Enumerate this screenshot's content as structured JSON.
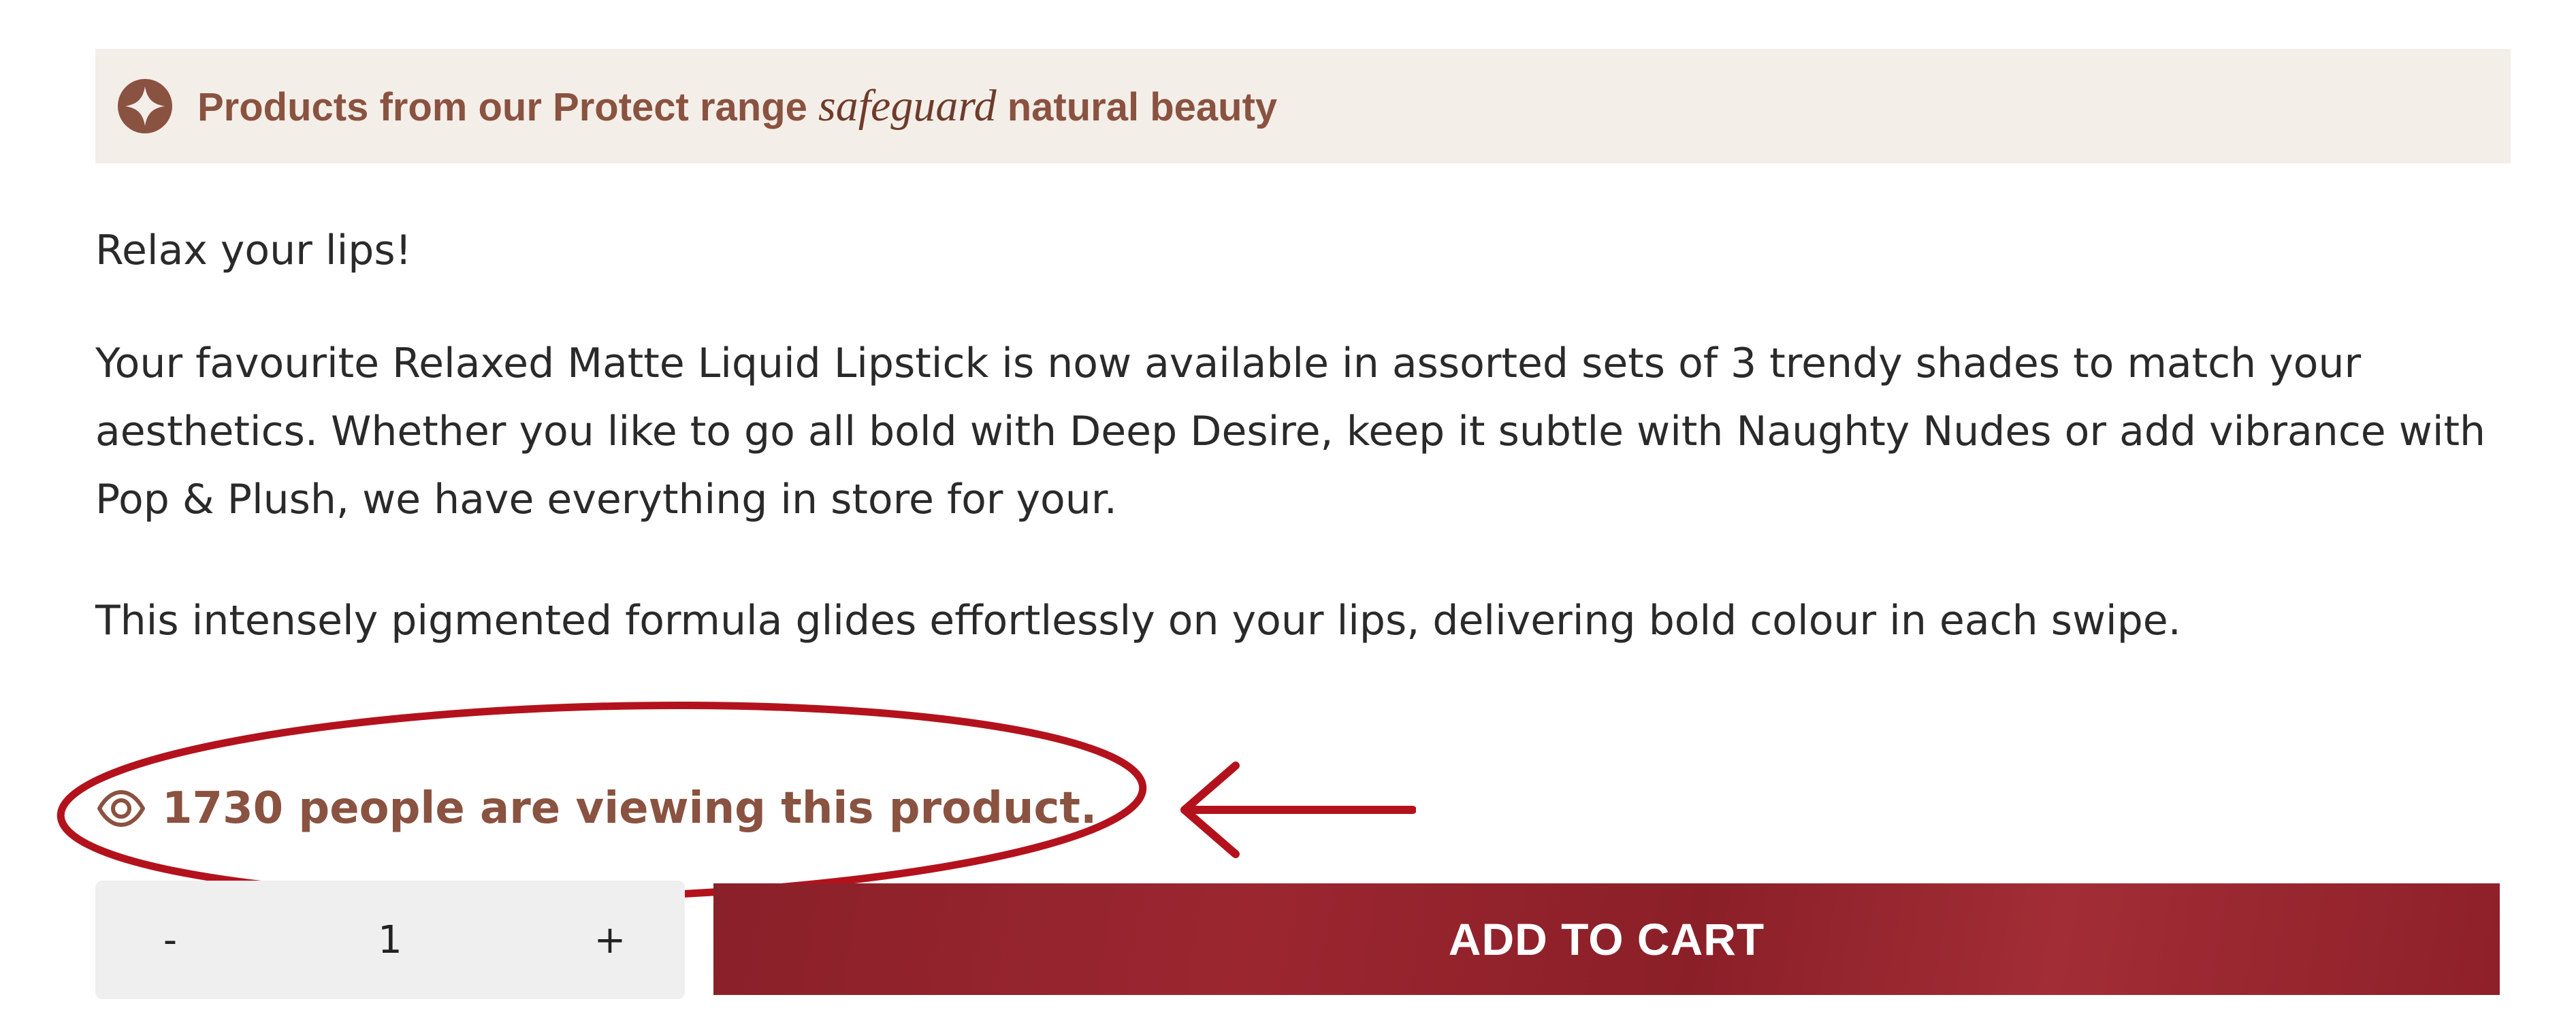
{
  "banner": {
    "icon": "compass-star-icon",
    "text_before": "Products from our Protect range ",
    "script_word": "safeguard",
    "text_after": " natural beauty",
    "bg_color": "#f4eee8",
    "text_color": "#8a5240"
  },
  "description": {
    "intro": "Relax your lips!",
    "body": "Your favourite Relaxed Matte Liquid Lipstick is now available in assorted sets of 3 trendy shades to match your aesthetics. Whether you like to go all bold with Deep Desire, keep it subtle with Naughty Nudes or add vibrance with Pop & Plush, we have everything in store for your.",
    "formula": "This intensely pigmented formula glides effortlessly on your lips, delivering bold colour in each swipe."
  },
  "viewers": {
    "icon": "eye-icon",
    "text": "1730 people are viewing this product.",
    "color": "#8a5240"
  },
  "annotation": {
    "ellipse_color": "#b3121d",
    "arrow_color": "#b3121d"
  },
  "quantity": {
    "decrement_label": "-",
    "value": "1",
    "increment_label": "+"
  },
  "add_to_cart": {
    "label": "ADD TO CART",
    "color": "#8e2029"
  }
}
